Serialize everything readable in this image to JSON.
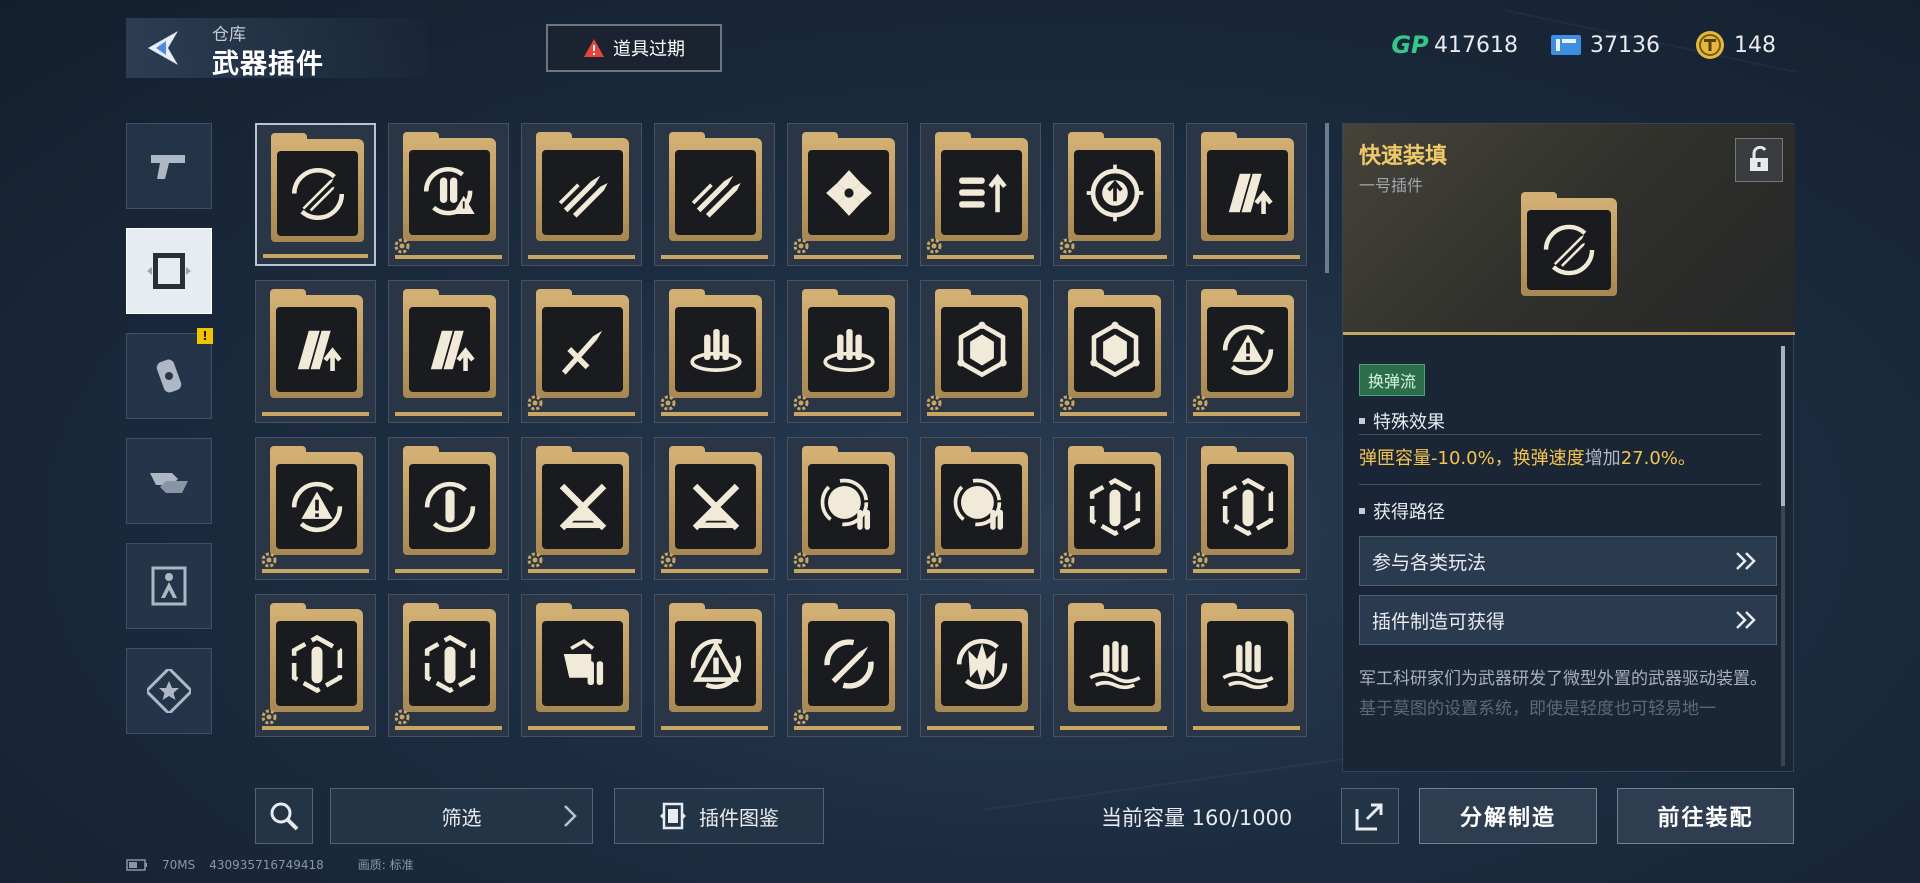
{
  "header": {
    "crumb": "仓库",
    "title": "武器插件",
    "warning_label": "道具过期"
  },
  "currencies": [
    {
      "icon": "gp-icon",
      "symbol": "GP",
      "value": "417618"
    },
    {
      "icon": "ticket-icon",
      "symbol": "",
      "value": "37136"
    },
    {
      "icon": "coin-icon",
      "symbol": "",
      "value": "148"
    }
  ],
  "side_tabs": [
    {
      "name": "pistol-icon",
      "active": false,
      "badge": ""
    },
    {
      "name": "plugin-folder-icon",
      "active": true,
      "badge": ""
    },
    {
      "name": "grenade-icon",
      "active": false,
      "badge": "!"
    },
    {
      "name": "trade-hands-icon",
      "active": false,
      "badge": ""
    },
    {
      "name": "fighter-icon",
      "active": false,
      "badge": ""
    },
    {
      "name": "star-badge-icon",
      "active": false,
      "badge": ""
    }
  ],
  "plugins": [
    {
      "icon": "reload-rocket-icon",
      "gear": false
    },
    {
      "icon": "ammo-warning-icon",
      "gear": true
    },
    {
      "icon": "twin-rocket-icon",
      "gear": false
    },
    {
      "icon": "twin-rocket-icon",
      "gear": false
    },
    {
      "icon": "shatter-icon",
      "gear": true
    },
    {
      "icon": "bullet-speed-icon",
      "gear": true
    },
    {
      "icon": "target-up-icon",
      "gear": true
    },
    {
      "icon": "magazine-up-icon",
      "gear": false
    },
    {
      "icon": "magazine-up-icon",
      "gear": false
    },
    {
      "icon": "magazine-up-icon",
      "gear": false
    },
    {
      "icon": "crossed-rockets-icon",
      "gear": true
    },
    {
      "icon": "ammo-ring-icon",
      "gear": true
    },
    {
      "icon": "ammo-ring-icon",
      "gear": true
    },
    {
      "icon": "hex-web-icon",
      "gear": true
    },
    {
      "icon": "hex-web-icon",
      "gear": true
    },
    {
      "icon": "cycle-warning-icon",
      "gear": true
    },
    {
      "icon": "cycle-warning-icon",
      "gear": true
    },
    {
      "icon": "cycle-bullet-icon",
      "gear": false
    },
    {
      "icon": "crossed-blades-icon",
      "gear": true
    },
    {
      "icon": "crossed-blades-icon",
      "gear": true
    },
    {
      "icon": "sphere-ammo-icon",
      "gear": true
    },
    {
      "icon": "sphere-ammo-icon",
      "gear": true
    },
    {
      "icon": "hex-bullet-icon",
      "gear": true
    },
    {
      "icon": "hex-bullet-icon",
      "gear": true
    },
    {
      "icon": "hex-bullet-icon",
      "gear": true
    },
    {
      "icon": "hex-bullet-icon",
      "gear": true
    },
    {
      "icon": "fist-ammo-icon",
      "gear": false
    },
    {
      "icon": "triangle-cycle-icon",
      "gear": false
    },
    {
      "icon": "swirl-rocket-icon",
      "gear": true
    },
    {
      "icon": "spike-cycle-icon",
      "gear": false
    },
    {
      "icon": "ammo-wave-icon",
      "gear": false
    },
    {
      "icon": "ammo-wave-icon",
      "gear": false
    }
  ],
  "detail": {
    "name": "快速装填",
    "slot": "一号插件",
    "tag": "换弹流",
    "effect_title": "特殊效果",
    "effect_part1": "弹匣容量-10.0%，换弹速度",
    "effect_plain": "增加",
    "effect_part2": "27.0%。",
    "source_title": "获得路径",
    "routes": [
      "参与各类玩法",
      "插件制造可获得"
    ],
    "description": "军工科研家们为武器研发了微型外置的武器驱动装置。",
    "description_faded": "基于莫图的设置系统，即使是轻度也可轻易地一"
  },
  "bottom": {
    "filter_label": "筛选",
    "codex_label": "插件图鉴",
    "capacity_label": "当前容量 160/1000",
    "decompose_label": "分解制造",
    "equip_label": "前往装配"
  },
  "status": {
    "ping": "70MS",
    "id": "430935716749418",
    "quality_label": "画质:",
    "quality_value": "标准"
  }
}
